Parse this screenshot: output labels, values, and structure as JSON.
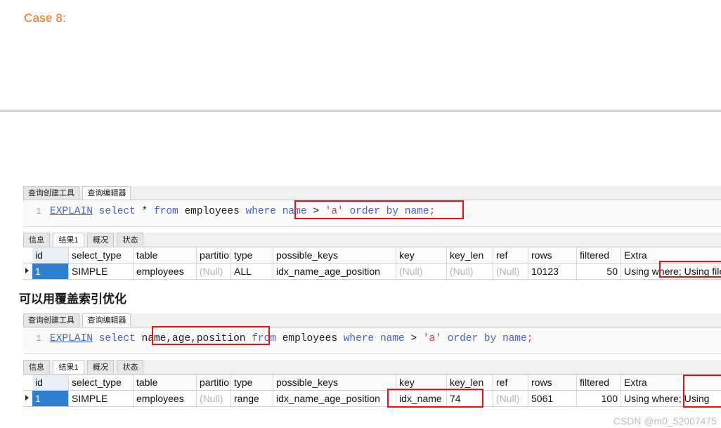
{
  "page": {
    "case_title": "Case 8:",
    "note_cn": "可以用覆盖索引优化",
    "watermark": "CSDN @m0_52007475"
  },
  "editor_tabs": {
    "builder_label": "查询创建工具",
    "editor_label": "查询编辑器"
  },
  "result_tabs": {
    "info_label": "信息",
    "result_label": "结果1",
    "profile_label": "概况",
    "status_label": "状态"
  },
  "grid_headers": {
    "id": "id",
    "select_type": "select_type",
    "table": "table",
    "partitions": "partitio",
    "type": "type",
    "possible_keys": "possible_keys",
    "key": "key",
    "key_len": "key_len",
    "ref": "ref",
    "rows": "rows",
    "filtered": "filtered",
    "extra": "Extra"
  },
  "block1": {
    "sql": {
      "line_number": "1",
      "t1": "EXPLAIN",
      "t2": "select",
      "t3": "*",
      "t4": "from",
      "t5": "employees",
      "t6": "where",
      "t7": "name",
      "t8": ">",
      "t9": "'a'",
      "t10": "order by",
      "t11": "name",
      "t12": ";"
    },
    "row": {
      "id": "1",
      "select_type": "SIMPLE",
      "table": "employees",
      "partitions": "(Null)",
      "type": "ALL",
      "possible_keys": "idx_name_age_position",
      "key": "(Null)",
      "key_len": "(Null)",
      "ref": "(Null)",
      "rows": "10123",
      "filtered": "50",
      "extra": "Using where; Using fileso"
    }
  },
  "block2": {
    "sql": {
      "line_number": "1",
      "t1": "EXPLAIN",
      "t2": "select",
      "t3": "name,age,position",
      "t4": "from",
      "t5": "employees",
      "t6": "where",
      "t7": "name",
      "t8": ">",
      "t9": "'a'",
      "t10": "order by",
      "t11": "name",
      "t12": ";"
    },
    "row": {
      "id": "1",
      "select_type": "SIMPLE",
      "table": "employees",
      "partitions": "(Null)",
      "type": "range",
      "possible_keys": "idx_name_age_position",
      "key": "idx_name",
      "key_len": "74",
      "ref": "(Null)",
      "rows": "5061",
      "filtered": "100",
      "extra": "Using where; Using"
    }
  },
  "colors": {
    "accent_orange": "#ff6a13",
    "annotation_red": "#ee1111",
    "selection_blue": "#2f7fd0",
    "keyword_blue": "#4a5fd0",
    "string_red": "#e03a3a"
  }
}
